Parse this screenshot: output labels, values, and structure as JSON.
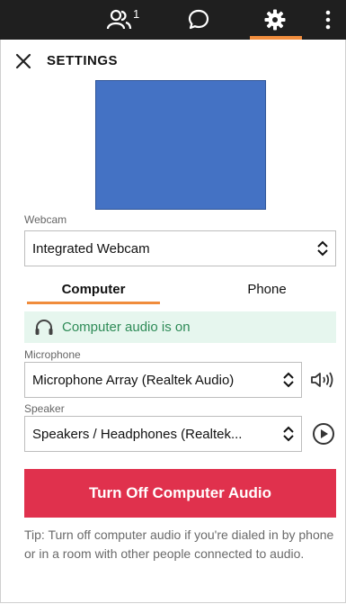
{
  "topbar": {
    "participants_count": "1",
    "icons": [
      "people-icon",
      "chat-icon",
      "gear-icon",
      "more-vertical-icon"
    ],
    "active_color": "#f08c3c"
  },
  "header": {
    "title": "SETTINGS"
  },
  "webcam": {
    "label": "Webcam",
    "value": "Integrated Webcam"
  },
  "tabs": [
    {
      "label": "Computer"
    },
    {
      "label": "Phone"
    }
  ],
  "status": {
    "text": "Computer audio is on"
  },
  "microphone": {
    "label": "Microphone",
    "value": "Microphone Array (Realtek Audio)"
  },
  "speaker": {
    "label": "Speaker",
    "value": "Speakers / Headphones (Realtek..."
  },
  "button": {
    "label": "Turn Off Computer Audio",
    "color": "#e0314d"
  },
  "tip": {
    "text": "Tip: Turn off computer audio if you're dialed in by phone or in a room with other people connected to audio."
  }
}
